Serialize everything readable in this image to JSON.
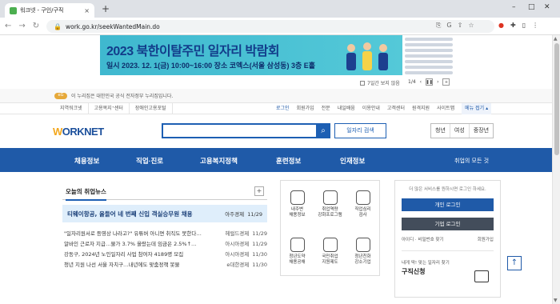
{
  "browser": {
    "tab_title": "워크넷 - 구인/구직",
    "url": "work.go.kr/seekWantedMain.do",
    "new_tab": "+",
    "tab_close": "×"
  },
  "banner": {
    "title": "2023 북한이탈주민 일자리 박람회",
    "details": "일시 2023. 12. 1(금) 10:00~16:00   장소 코엑스(서울 삼성동) 3층 E홀",
    "no_show_today": "7일간 보지 않음",
    "counter": "1/4"
  },
  "gov_notice": "이 누리집은 대한민국 공식 전자정부 누리집입니다.",
  "util_left": [
    "지역워크넷",
    "고용복지⁺센터",
    "장애인고용포털"
  ],
  "util_right": [
    "로그인",
    "회원가입",
    "전문",
    "내일배움",
    "이용안내",
    "고객센터",
    "원격지원",
    "사이트맵"
  ],
  "util_menu": "메뉴 접기 ▴",
  "header": {
    "logo_w": "W",
    "logo_rest": "ORKNET",
    "search_placeholder": "",
    "search_btn_label": "일자리 검색",
    "segments": [
      "청년",
      "여성",
      "중장년"
    ]
  },
  "gnb": {
    "items": [
      "채용정보",
      "직업·진로",
      "고용복지정책",
      "훈련정보",
      "인재정보"
    ],
    "all": "취업의 모든 것"
  },
  "news": {
    "title": "오늘의 취업뉴스",
    "plus": "+",
    "headline": "티웨이항공, 올들어 네 번째 신입 객실승무원 채용",
    "headline_src": "아주경제",
    "headline_date": "11/29",
    "rows": [
      {
        "t": "\"일자리원서로 등영상 나라고?\" 유튜버 아니면 취직도 못한다…",
        "s": "헤럴드경제",
        "d": "11/29"
      },
      {
        "t": "알바인 근로자 지급…물가 3.7% 올랐는데 임금은 2.5%↑…",
        "s": "아시아경제",
        "d": "11/29"
      },
      {
        "t": "강동구, 2024년 노인일자리 사업 참여자 4189명 모집",
        "s": "아시아경제",
        "d": "11/30"
      },
      {
        "t": "청년 지원 나선 서울 자치구…내년에도 맞춤정책 봇물",
        "s": "e대한경제",
        "d": "11/30"
      }
    ]
  },
  "services": [
    {
      "label": "내주변\n채용정보",
      "icon": "house-icon"
    },
    {
      "label": "취업역량\n강화프로그램",
      "icon": "plant-icon"
    },
    {
      "label": "직업심리\n검사",
      "icon": "check-icon"
    },
    {
      "label": "청년도약\n채용공채",
      "icon": "people-icon"
    },
    {
      "label": "국민취업\n지원제도",
      "icon": "person-icon"
    },
    {
      "label": "청년친화\n강소기업",
      "icon": "building-icon"
    }
  ],
  "login": {
    "msg": "더 많은 서비스를 원하시면 로그인 하세요.",
    "personal": "개인 로그인",
    "company": "기업 로그인",
    "id_pw": "아이디 · 비밀번호 찾기",
    "join": "회원가입",
    "ask": "내게 딱! 맞는 일자리 찾기",
    "register": "구직신청"
  },
  "colors": {
    "primary": "#1f5aa8",
    "news_bg": "#dfeefb",
    "banner": "#3fb8cf"
  }
}
